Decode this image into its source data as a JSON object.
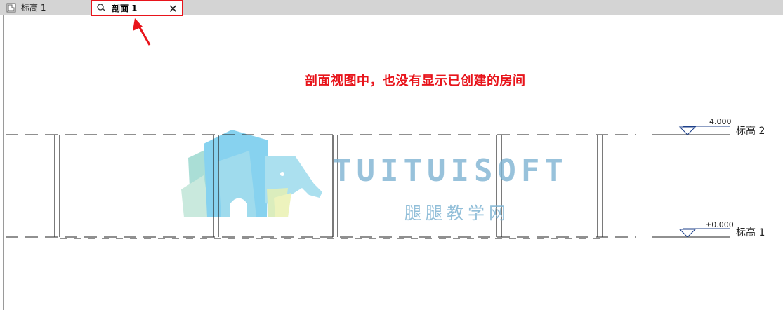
{
  "tabs": [
    {
      "label": "标高 1",
      "icon": "floor-plan-icon",
      "active": false
    },
    {
      "label": "剖面 1",
      "icon": "section-view-icon",
      "active": true,
      "close_glyph": "✕"
    }
  ],
  "annotation": {
    "text": "剖面视图中，也没有显示已创建的房间",
    "color": "#e8141b"
  },
  "levels": [
    {
      "name": "标高 2",
      "elevation": "4.000"
    },
    {
      "name": "标高 1",
      "elevation": "±0.000"
    }
  ],
  "watermark": {
    "brand": "TUITUISOFT",
    "subtitle": "腿腿教学网"
  },
  "colors": {
    "highlight": "#e8141b",
    "level_marker": "#1c3f8a",
    "watermark": "#7fb4d3"
  }
}
